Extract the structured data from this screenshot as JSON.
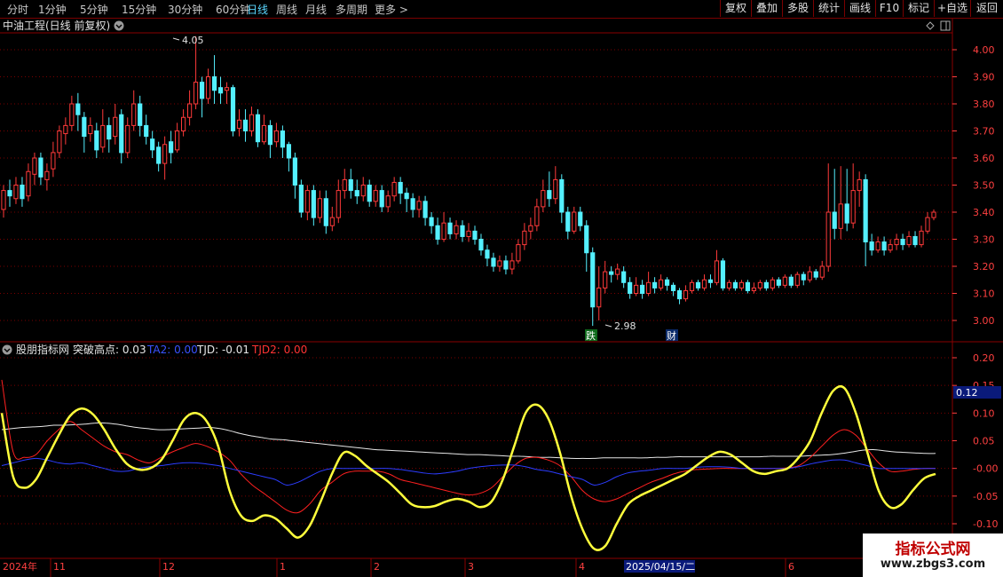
{
  "toolbar": {
    "timeframes": [
      "分时",
      "1分钟",
      "5分钟",
      "15分钟",
      "30分钟",
      "60分钟",
      "日线",
      "周线",
      "月线",
      "多周期",
      "更多"
    ],
    "active_index": 6,
    "right_buttons": [
      "复权",
      "叠加",
      "多股",
      "统计",
      "画线",
      "F10",
      "标记",
      "+自选",
      "返回"
    ]
  },
  "main_panel": {
    "title": "中油工程(日线 前复权)",
    "high_label": "4.05",
    "low_label": "2.98",
    "markers": [
      "跌",
      "财"
    ],
    "y_ticks": [
      "4.00",
      "3.90",
      "3.80",
      "3.70",
      "3.60",
      "3.50",
      "3.40",
      "3.30",
      "3.20",
      "3.10",
      "3.00"
    ]
  },
  "indicator_panel": {
    "title": "股朋指标网",
    "legend": [
      {
        "label": "突破高点: 0.03",
        "color": "#e6e6e6"
      },
      {
        "label": "TA2: 0.00",
        "color": "#3a52ff"
      },
      {
        "label": "TJD: -0.01",
        "color": "#e6e6e6"
      },
      {
        "label": "TJD2: 0.00",
        "color": "#ff3333"
      }
    ],
    "y_ticks": [
      "0.20",
      "0.15",
      "0.10",
      "0.05",
      "-0.00",
      "-0.05",
      "-0.10"
    ],
    "last_value": "0.12"
  },
  "x_axis": {
    "labels": [
      "2024年",
      "11",
      "12",
      "1",
      "2",
      "3",
      "4",
      "2025/04/15/二",
      "6"
    ]
  },
  "watermark": {
    "line1": "指标公式网",
    "line2": "www.zbgs3.com"
  },
  "colors": {
    "up": "#ff3a3a",
    "down": "#54f0ff",
    "yellow": "#ffff3c",
    "white": "#e6e6e6",
    "red": "#ff2020",
    "blue": "#2c3cff",
    "grid": "#7a0000"
  },
  "chart_data": {
    "type": "candlestick",
    "price_range": [
      2.95,
      4.05
    ],
    "candles": [
      [
        3.41,
        3.48,
        3.38,
        3.5
      ],
      [
        3.48,
        3.46,
        3.42,
        3.52
      ],
      [
        3.45,
        3.5,
        3.43,
        3.53
      ],
      [
        3.5,
        3.45,
        3.42,
        3.53
      ],
      [
        3.46,
        3.55,
        3.44,
        3.58
      ],
      [
        3.54,
        3.6,
        3.5,
        3.62
      ],
      [
        3.6,
        3.53,
        3.5,
        3.62
      ],
      [
        3.52,
        3.55,
        3.48,
        3.58
      ],
      [
        3.56,
        3.62,
        3.53,
        3.66
      ],
      [
        3.62,
        3.7,
        3.6,
        3.72
      ],
      [
        3.69,
        3.72,
        3.65,
        3.75
      ],
      [
        3.72,
        3.8,
        3.7,
        3.83
      ],
      [
        3.8,
        3.76,
        3.7,
        3.84
      ],
      [
        3.75,
        3.68,
        3.62,
        3.77
      ],
      [
        3.69,
        3.72,
        3.66,
        3.75
      ],
      [
        3.7,
        3.63,
        3.6,
        3.73
      ],
      [
        3.64,
        3.72,
        3.62,
        3.78
      ],
      [
        3.72,
        3.67,
        3.62,
        3.75
      ],
      [
        3.68,
        3.75,
        3.65,
        3.8
      ],
      [
        3.76,
        3.62,
        3.58,
        3.78
      ],
      [
        3.62,
        3.72,
        3.6,
        3.75
      ],
      [
        3.72,
        3.8,
        3.7,
        3.85
      ],
      [
        3.8,
        3.72,
        3.68,
        3.83
      ],
      [
        3.72,
        3.68,
        3.65,
        3.76
      ],
      [
        3.67,
        3.63,
        3.6,
        3.7
      ],
      [
        3.64,
        3.58,
        3.55,
        3.66
      ],
      [
        3.58,
        3.65,
        3.52,
        3.68
      ],
      [
        3.66,
        3.62,
        3.58,
        3.7
      ],
      [
        3.63,
        3.7,
        3.62,
        3.73
      ],
      [
        3.7,
        3.75,
        3.68,
        3.78
      ],
      [
        3.75,
        3.8,
        3.72,
        3.85
      ],
      [
        3.8,
        3.88,
        3.78,
        4.05
      ],
      [
        3.88,
        3.82,
        3.75,
        3.9
      ],
      [
        3.82,
        3.9,
        3.8,
        3.93
      ],
      [
        3.9,
        3.85,
        3.8,
        3.98
      ],
      [
        3.86,
        3.84,
        3.8,
        3.9
      ],
      [
        3.85,
        3.86,
        3.8,
        3.88
      ],
      [
        3.86,
        3.7,
        3.68,
        3.87
      ],
      [
        3.71,
        3.74,
        3.68,
        3.78
      ],
      [
        3.74,
        3.7,
        3.66,
        3.78
      ],
      [
        3.7,
        3.76,
        3.68,
        3.79
      ],
      [
        3.76,
        3.66,
        3.64,
        3.78
      ],
      [
        3.66,
        3.72,
        3.65,
        3.76
      ],
      [
        3.72,
        3.65,
        3.6,
        3.74
      ],
      [
        3.66,
        3.7,
        3.64,
        3.73
      ],
      [
        3.7,
        3.64,
        3.6,
        3.72
      ],
      [
        3.65,
        3.6,
        3.55,
        3.66
      ],
      [
        3.6,
        3.5,
        3.45,
        3.62
      ],
      [
        3.5,
        3.4,
        3.38,
        3.52
      ],
      [
        3.4,
        3.48,
        3.37,
        3.5
      ],
      [
        3.48,
        3.38,
        3.35,
        3.5
      ],
      [
        3.38,
        3.45,
        3.36,
        3.48
      ],
      [
        3.45,
        3.35,
        3.32,
        3.48
      ],
      [
        3.35,
        3.38,
        3.33,
        3.42
      ],
      [
        3.38,
        3.48,
        3.36,
        3.52
      ],
      [
        3.48,
        3.52,
        3.45,
        3.56
      ],
      [
        3.52,
        3.48,
        3.45,
        3.56
      ],
      [
        3.48,
        3.46,
        3.43,
        3.52
      ],
      [
        3.46,
        3.5,
        3.44,
        3.53
      ],
      [
        3.5,
        3.44,
        3.42,
        3.52
      ],
      [
        3.44,
        3.48,
        3.42,
        3.5
      ],
      [
        3.48,
        3.42,
        3.4,
        3.5
      ],
      [
        3.42,
        3.46,
        3.4,
        3.48
      ],
      [
        3.46,
        3.51,
        3.44,
        3.53
      ],
      [
        3.51,
        3.47,
        3.43,
        3.53
      ],
      [
        3.47,
        3.45,
        3.4,
        3.49
      ],
      [
        3.45,
        3.41,
        3.38,
        3.47
      ],
      [
        3.41,
        3.44,
        3.38,
        3.46
      ],
      [
        3.44,
        3.38,
        3.35,
        3.46
      ],
      [
        3.38,
        3.35,
        3.32,
        3.4
      ],
      [
        3.35,
        3.3,
        3.28,
        3.38
      ],
      [
        3.3,
        3.36,
        3.29,
        3.4
      ],
      [
        3.36,
        3.32,
        3.3,
        3.38
      ],
      [
        3.32,
        3.35,
        3.3,
        3.37
      ],
      [
        3.35,
        3.31,
        3.29,
        3.37
      ],
      [
        3.31,
        3.33,
        3.29,
        3.36
      ],
      [
        3.33,
        3.3,
        3.28,
        3.35
      ],
      [
        3.3,
        3.26,
        3.24,
        3.32
      ],
      [
        3.26,
        3.23,
        3.2,
        3.28
      ],
      [
        3.23,
        3.2,
        3.18,
        3.25
      ],
      [
        3.2,
        3.22,
        3.18,
        3.24
      ],
      [
        3.22,
        3.19,
        3.17,
        3.24
      ],
      [
        3.19,
        3.22,
        3.17,
        3.25
      ],
      [
        3.22,
        3.28,
        3.21,
        3.3
      ],
      [
        3.28,
        3.33,
        3.26,
        3.36
      ],
      [
        3.33,
        3.35,
        3.3,
        3.38
      ],
      [
        3.35,
        3.42,
        3.33,
        3.45
      ],
      [
        3.42,
        3.48,
        3.4,
        3.52
      ],
      [
        3.48,
        3.45,
        3.42,
        3.55
      ],
      [
        3.45,
        3.52,
        3.43,
        3.57
      ],
      [
        3.52,
        3.4,
        3.36,
        3.54
      ],
      [
        3.4,
        3.33,
        3.3,
        3.42
      ],
      [
        3.33,
        3.4,
        3.32,
        3.42
      ],
      [
        3.4,
        3.35,
        3.33,
        3.42
      ],
      [
        3.35,
        3.25,
        3.18,
        3.37
      ],
      [
        3.25,
        3.05,
        2.98,
        3.27
      ],
      [
        3.05,
        3.12,
        3.0,
        3.2
      ],
      [
        3.12,
        3.18,
        3.1,
        3.22
      ],
      [
        3.18,
        3.17,
        3.14,
        3.2
      ],
      [
        3.17,
        3.19,
        3.15,
        3.21
      ],
      [
        3.18,
        3.14,
        3.12,
        3.2
      ],
      [
        3.14,
        3.1,
        3.08,
        3.16
      ],
      [
        3.1,
        3.13,
        3.09,
        3.16
      ],
      [
        3.13,
        3.1,
        3.08,
        3.15
      ],
      [
        3.1,
        3.14,
        3.09,
        3.18
      ],
      [
        3.14,
        3.12,
        3.1,
        3.16
      ],
      [
        3.12,
        3.15,
        3.11,
        3.17
      ],
      [
        3.15,
        3.13,
        3.11,
        3.16
      ],
      [
        3.13,
        3.11,
        3.09,
        3.14
      ],
      [
        3.11,
        3.08,
        3.06,
        3.12
      ],
      [
        3.08,
        3.11,
        3.07,
        3.13
      ],
      [
        3.11,
        3.14,
        3.1,
        3.15
      ],
      [
        3.14,
        3.12,
        3.11,
        3.15
      ],
      [
        3.12,
        3.15,
        3.11,
        3.17
      ],
      [
        3.15,
        3.14,
        3.12,
        3.17
      ],
      [
        3.14,
        3.22,
        3.13,
        3.26
      ],
      [
        3.22,
        3.12,
        3.11,
        3.23
      ],
      [
        3.12,
        3.14,
        3.11,
        3.15
      ],
      [
        3.14,
        3.12,
        3.11,
        3.15
      ],
      [
        3.12,
        3.14,
        3.11,
        3.15
      ],
      [
        3.14,
        3.11,
        3.1,
        3.15
      ],
      [
        3.11,
        3.12,
        3.1,
        3.14
      ],
      [
        3.12,
        3.14,
        3.11,
        3.15
      ],
      [
        3.14,
        3.12,
        3.11,
        3.15
      ],
      [
        3.12,
        3.15,
        3.11,
        3.16
      ],
      [
        3.15,
        3.13,
        3.12,
        3.16
      ],
      [
        3.13,
        3.16,
        3.12,
        3.17
      ],
      [
        3.16,
        3.13,
        3.12,
        3.17
      ],
      [
        3.13,
        3.17,
        3.12,
        3.18
      ],
      [
        3.17,
        3.15,
        3.13,
        3.18
      ],
      [
        3.15,
        3.18,
        3.14,
        3.2
      ],
      [
        3.18,
        3.16,
        3.15,
        3.19
      ],
      [
        3.16,
        3.2,
        3.15,
        3.22
      ],
      [
        3.2,
        3.4,
        3.18,
        3.58
      ],
      [
        3.4,
        3.34,
        3.3,
        3.56
      ],
      [
        3.34,
        3.43,
        3.3,
        3.57
      ],
      [
        3.43,
        3.36,
        3.33,
        3.56
      ],
      [
        3.36,
        3.48,
        3.34,
        3.58
      ],
      [
        3.48,
        3.52,
        3.42,
        3.55
      ],
      [
        3.52,
        3.29,
        3.2,
        3.54
      ],
      [
        3.29,
        3.26,
        3.24,
        3.32
      ],
      [
        3.26,
        3.29,
        3.25,
        3.31
      ],
      [
        3.29,
        3.26,
        3.24,
        3.31
      ],
      [
        3.26,
        3.28,
        3.25,
        3.3
      ],
      [
        3.28,
        3.3,
        3.26,
        3.32
      ],
      [
        3.3,
        3.28,
        3.26,
        3.32
      ],
      [
        3.28,
        3.31,
        3.27,
        3.33
      ],
      [
        3.31,
        3.28,
        3.27,
        3.33
      ],
      [
        3.28,
        3.33,
        3.27,
        3.35
      ],
      [
        3.33,
        3.38,
        3.32,
        3.4
      ],
      [
        3.38,
        3.4,
        3.37,
        3.41
      ]
    ],
    "indicator_range": [
      -0.12,
      0.22
    ],
    "series": [
      {
        "name": "突破高点",
        "values": [
          0.07,
          0.072,
          0.074,
          0.075,
          0.076,
          0.078,
          0.078,
          0.079,
          0.08,
          0.082,
          0.082,
          0.08,
          0.077,
          0.074,
          0.072,
          0.07,
          0.07,
          0.071,
          0.072,
          0.073,
          0.074,
          0.072,
          0.068,
          0.063,
          0.059,
          0.056,
          0.053,
          0.052,
          0.05,
          0.048,
          0.046,
          0.044,
          0.042,
          0.04,
          0.038,
          0.036,
          0.034,
          0.033,
          0.032,
          0.031,
          0.03,
          0.029,
          0.028,
          0.027,
          0.026,
          0.025,
          0.025,
          0.024,
          0.023,
          0.022,
          0.022,
          0.021,
          0.02,
          0.02,
          0.019,
          0.018,
          0.018,
          0.018,
          0.019,
          0.019,
          0.019,
          0.019,
          0.019,
          0.02,
          0.02,
          0.021,
          0.021,
          0.021,
          0.021,
          0.021,
          0.021,
          0.021,
          0.021,
          0.021,
          0.022,
          0.022,
          0.022,
          0.022,
          0.023,
          0.024,
          0.025,
          0.027,
          0.03,
          0.033,
          0.034,
          0.032,
          0.03,
          0.029,
          0.028,
          0.027,
          0.027
        ]
      },
      {
        "name": "TJD",
        "values": [
          0.1,
          -0.015,
          -0.035,
          -0.02,
          0.02,
          0.06,
          0.095,
          0.108,
          0.098,
          0.07,
          0.035,
          0.008,
          -0.002,
          0.0,
          0.015,
          0.05,
          0.088,
          0.1,
          0.085,
          0.04,
          -0.04,
          -0.085,
          -0.095,
          -0.085,
          -0.09,
          -0.108,
          -0.125,
          -0.105,
          -0.06,
          -0.01,
          0.028,
          0.023,
          0.005,
          -0.01,
          -0.025,
          -0.045,
          -0.065,
          -0.07,
          -0.068,
          -0.06,
          -0.055,
          -0.06,
          -0.07,
          -0.06,
          -0.02,
          0.04,
          0.1,
          0.115,
          0.09,
          0.03,
          -0.05,
          -0.11,
          -0.145,
          -0.14,
          -0.1,
          -0.065,
          -0.05,
          -0.04,
          -0.03,
          -0.02,
          -0.01,
          0.005,
          0.02,
          0.03,
          0.025,
          0.01,
          -0.005,
          -0.01,
          -0.005,
          0.0,
          0.02,
          0.05,
          0.1,
          0.14,
          0.145,
          0.1,
          0.03,
          -0.04,
          -0.07,
          -0.065,
          -0.04,
          -0.018,
          -0.01
        ]
      },
      {
        "name": "TJD2",
        "values": [
          0.16,
          0.03,
          0.02,
          0.025,
          0.05,
          0.07,
          0.085,
          0.07,
          0.055,
          0.04,
          0.03,
          0.025,
          0.015,
          0.01,
          0.02,
          0.03,
          0.038,
          0.045,
          0.04,
          0.03,
          0.015,
          -0.01,
          -0.03,
          -0.045,
          -0.06,
          -0.075,
          -0.08,
          -0.065,
          -0.04,
          -0.025,
          -0.01,
          -0.005,
          -0.005,
          -0.005,
          -0.01,
          -0.02,
          -0.025,
          -0.03,
          -0.035,
          -0.04,
          -0.045,
          -0.048,
          -0.045,
          -0.035,
          -0.015,
          0.005,
          0.018,
          0.02,
          0.015,
          0.005,
          -0.015,
          -0.04,
          -0.055,
          -0.06,
          -0.055,
          -0.045,
          -0.035,
          -0.025,
          -0.018,
          -0.01,
          -0.005,
          -0.002,
          -0.001,
          0.0,
          0.0,
          0.0,
          0.0,
          0.0,
          0.0,
          0.001,
          0.005,
          0.02,
          0.04,
          0.06,
          0.07,
          0.06,
          0.035,
          0.01,
          -0.005,
          -0.005,
          -0.002,
          0.0,
          0.0
        ]
      },
      {
        "name": "TA2",
        "values": [
          0.005,
          0.01,
          0.015,
          0.018,
          0.015,
          0.01,
          0.008,
          0.01,
          0.005,
          0.0,
          -0.005,
          -0.005,
          0.0,
          0.003,
          0.005,
          0.008,
          0.01,
          0.01,
          0.008,
          0.005,
          0.0,
          -0.005,
          -0.01,
          -0.015,
          -0.02,
          -0.03,
          -0.025,
          -0.015,
          -0.005,
          0.0,
          0.0,
          0.0,
          0.0,
          0.0,
          0.0,
          -0.002,
          -0.005,
          -0.008,
          -0.01,
          -0.008,
          -0.005,
          0.0,
          0.003,
          0.005,
          0.006,
          0.006,
          0.003,
          -0.002,
          -0.005,
          -0.01,
          -0.015,
          -0.02,
          -0.03,
          -0.025,
          -0.015,
          -0.008,
          -0.005,
          -0.003,
          0.0,
          0.0,
          0.0,
          0.002,
          0.003,
          0.003,
          0.002,
          0.0,
          0.0,
          0.0,
          0.0,
          0.0,
          0.003,
          0.008,
          0.012,
          0.015,
          0.015,
          0.01,
          0.005,
          0.0,
          0.0,
          0.0,
          0.0,
          0.0,
          0.0
        ]
      }
    ]
  }
}
